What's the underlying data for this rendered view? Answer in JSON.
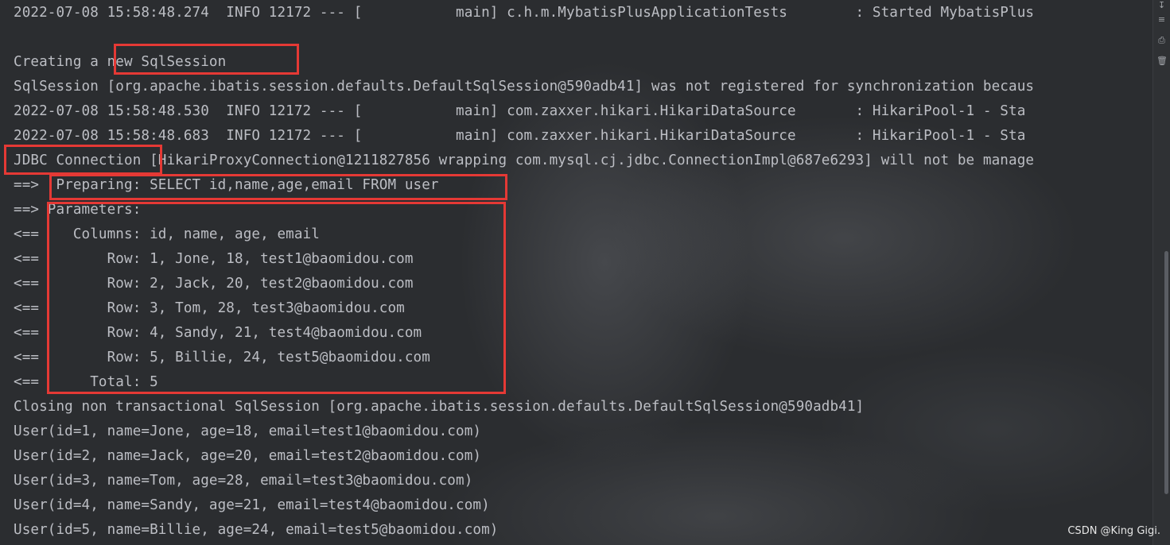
{
  "console": {
    "lines": [
      "2022-07-08 15:58:48.274  INFO 12172 --- [           main] c.h.m.MybatisPlusApplicationTests        : Started MybatisPlus",
      "",
      "Creating a new SqlSession",
      "SqlSession [org.apache.ibatis.session.defaults.DefaultSqlSession@590adb41] was not registered for synchronization becaus",
      "2022-07-08 15:58:48.530  INFO 12172 --- [           main] com.zaxxer.hikari.HikariDataSource       : HikariPool-1 - Sta",
      "2022-07-08 15:58:48.683  INFO 12172 --- [           main] com.zaxxer.hikari.HikariDataSource       : HikariPool-1 - Sta",
      "JDBC Connection [HikariProxyConnection@1211827856 wrapping com.mysql.cj.jdbc.ConnectionImpl@687e6293] will not be manage",
      "==>  Preparing: SELECT id,name,age,email FROM user",
      "==> Parameters: ",
      "<==    Columns: id, name, age, email",
      "<==        Row: 1, Jone, 18, test1@baomidou.com",
      "<==        Row: 2, Jack, 20, test2@baomidou.com",
      "<==        Row: 3, Tom, 28, test3@baomidou.com",
      "<==        Row: 4, Sandy, 21, test4@baomidou.com",
      "<==        Row: 5, Billie, 24, test5@baomidou.com",
      "<==      Total: 5",
      "Closing non transactional SqlSession [org.apache.ibatis.session.defaults.DefaultSqlSession@590adb41]",
      "User(id=1, name=Jone, age=18, email=test1@baomidou.com)",
      "User(id=2, name=Jack, age=20, email=test2@baomidou.com)",
      "User(id=3, name=Tom, age=28, email=test3@baomidou.com)",
      "User(id=4, name=Sandy, age=21, email=test4@baomidou.com)",
      "User(id=5, name=Billie, age=24, email=test5@baomidou.com)"
    ]
  },
  "gutter": {
    "icons": [
      "scroll-to-end-icon",
      "soft-wrap-icon",
      "print-icon",
      "trash-icon"
    ]
  },
  "watermark": "CSDN @King Gigi.",
  "colors": {
    "background": "#2b2d30",
    "text": "#bcbec4",
    "highlight_box": "#e53935"
  }
}
